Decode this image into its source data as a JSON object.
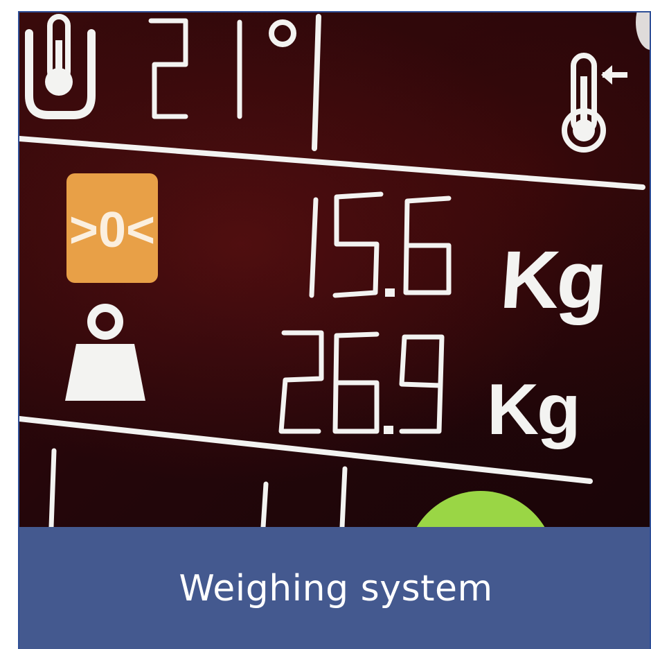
{
  "tile": {
    "caption": "Weighing system"
  },
  "display": {
    "temperature_reading": "21°",
    "readings": [
      {
        "value": "15.6",
        "unit": "Kg"
      },
      {
        "value": "26.9",
        "unit": "Kg"
      }
    ],
    "zero_badge_text": ">0<",
    "icons": [
      "tank-thermometer-icon",
      "ambient-thermometer-icon",
      "zero-tare-icon",
      "weight-icon",
      "status-indicator-icon"
    ]
  },
  "colors": {
    "card_border": "#2f4f97",
    "caption_bg": "#44598f",
    "caption_text": "#ffffff",
    "display_bg": "#2a070a",
    "segment": "#f3f3f1",
    "zero_badge": "#e8a047",
    "status_green": "#9ad645"
  }
}
